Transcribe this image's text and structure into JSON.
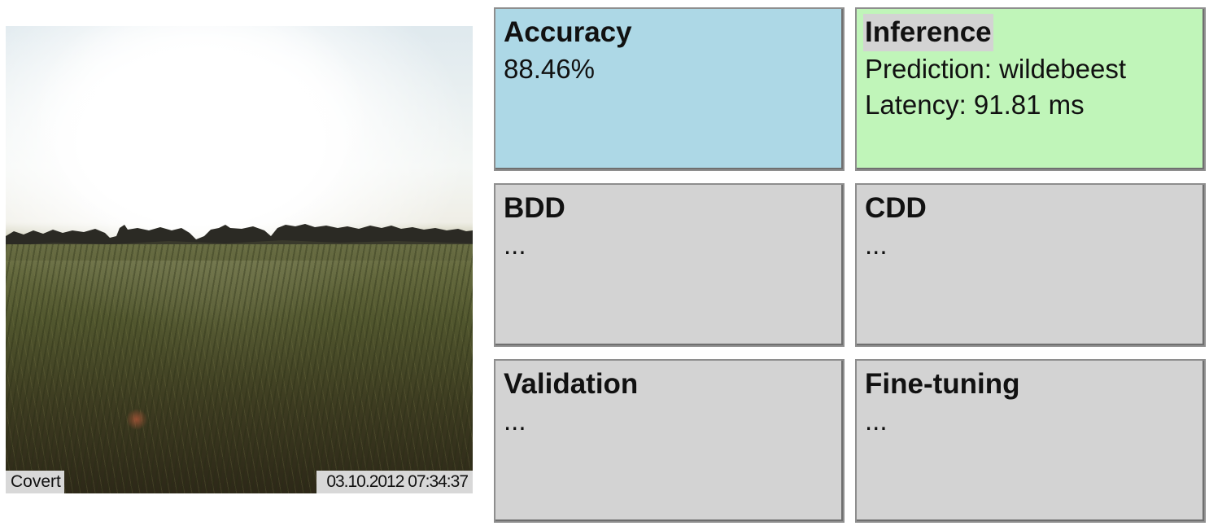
{
  "camera_image": {
    "label_left": "Covert",
    "label_right": "03.10.2012 07:34:37"
  },
  "panels": {
    "accuracy": {
      "title": "Accuracy",
      "lines": [
        "88.46%"
      ],
      "color": "#add8e6"
    },
    "inference": {
      "title": "Inference",
      "lines": [
        "Prediction: wildebeest",
        "Latency: 91.81 ms"
      ],
      "color": "#c0f5b9"
    },
    "bdd": {
      "title": "BDD",
      "lines": [
        "..."
      ],
      "color": "#d3d3d3"
    },
    "cdd": {
      "title": "CDD",
      "lines": [
        "..."
      ],
      "color": "#d3d3d3"
    },
    "validation": {
      "title": "Validation",
      "lines": [
        "..."
      ],
      "color": "#d3d3d3"
    },
    "finetuning": {
      "title": "Fine-tuning",
      "lines": [
        "..."
      ],
      "color": "#d3d3d3"
    }
  }
}
